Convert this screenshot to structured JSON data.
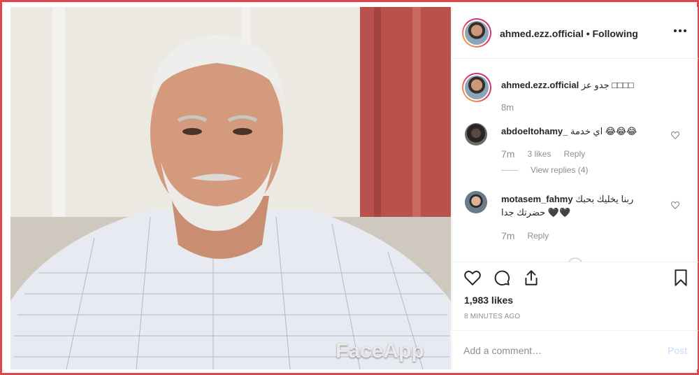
{
  "photo": {
    "watermark": "FaceApp"
  },
  "header": {
    "username": "ahmed.ezz.official",
    "separator": "•",
    "follow_state": "Following",
    "more_icon": "more-horizontal-icon"
  },
  "caption": {
    "username": "ahmed.ezz.official",
    "text": "جدو عز □□□□",
    "time": "8m"
  },
  "comments": [
    {
      "username": "abdoeltohamy_",
      "text": "اي خدمة 😂😂😂",
      "time": "7m",
      "likes": "3 likes",
      "reply": "Reply",
      "view_replies": "View replies (4)"
    },
    {
      "username": "motasem_fahmy",
      "text_line1": "ربنا يخليك بحبك",
      "text_line2": "حضرتك جدا 🖤🖤",
      "time": "7m",
      "reply": "Reply"
    }
  ],
  "actions": {
    "like_icon": "heart-icon",
    "comment_icon": "comment-icon",
    "share_icon": "share-icon",
    "save_icon": "bookmark-icon"
  },
  "likes": "1,983 likes",
  "posted_ago": "8 MINUTES AGO",
  "add_comment": {
    "placeholder": "Add a comment…",
    "post_label": "Post"
  },
  "colors": {
    "frame_border": "#e0474c",
    "text_primary": "#262626",
    "text_secondary": "#8e8e8e",
    "post_disabled": "#c5dcf5"
  }
}
